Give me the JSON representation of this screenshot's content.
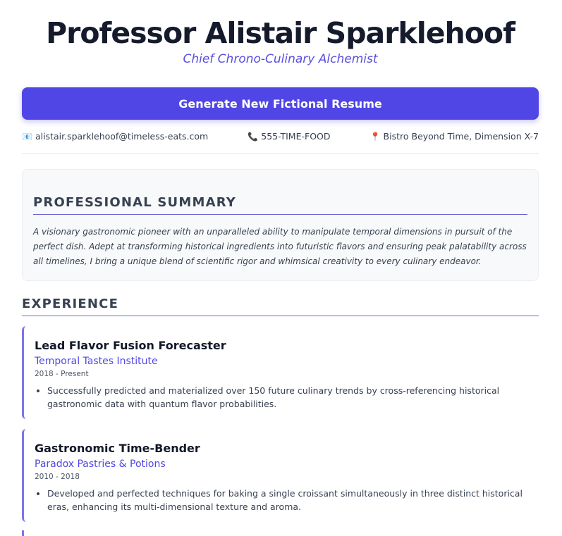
{
  "header": {
    "name": "Professor Alistair Sparklehoof",
    "title": "Chief Chrono-Culinary Alchemist"
  },
  "actions": {
    "generate_label": "Generate New Fictional Resume"
  },
  "contact": {
    "email_icon": "email-icon",
    "email": "alistair.sparklehoof@timeless-eats.com",
    "phone_icon": "phone-icon",
    "phone": "555-TIME-FOOD",
    "location_icon": "location-pin-icon",
    "location": "Bistro Beyond Time, Dimension X-7"
  },
  "summary": {
    "heading": "PROFESSIONAL SUMMARY",
    "text": "A visionary gastronomic pioneer with an unparalleled ability to manipulate temporal dimensions in pursuit of the perfect dish. Adept at transforming historical ingredients into futuristic flavors and ensuring peak palatability across all timelines, I bring a unique blend of scientific rigor and whimsical creativity to every culinary endeavor."
  },
  "experience": {
    "heading": "EXPERIENCE",
    "jobs": [
      {
        "title": "Lead Flavor Fusion Forecaster",
        "company": "Temporal Tastes Institute",
        "dates": "2018 - Present",
        "bullets": [
          "Successfully predicted and materialized over 150 future culinary trends by cross-referencing historical gastronomic data with quantum flavor probabilities."
        ]
      },
      {
        "title": "Gastronomic Time-Bender",
        "company": "Paradox Pastries & Potions",
        "dates": "2010 - 2018",
        "bullets": [
          "Developed and perfected techniques for baking a single croissant simultaneously in three distinct historical eras, enhancing its multi-dimensional texture and aroma."
        ]
      }
    ]
  },
  "colors": {
    "accent": "#4f46e5",
    "accent_light": "#7c75e8",
    "heading": "#151b2c"
  }
}
